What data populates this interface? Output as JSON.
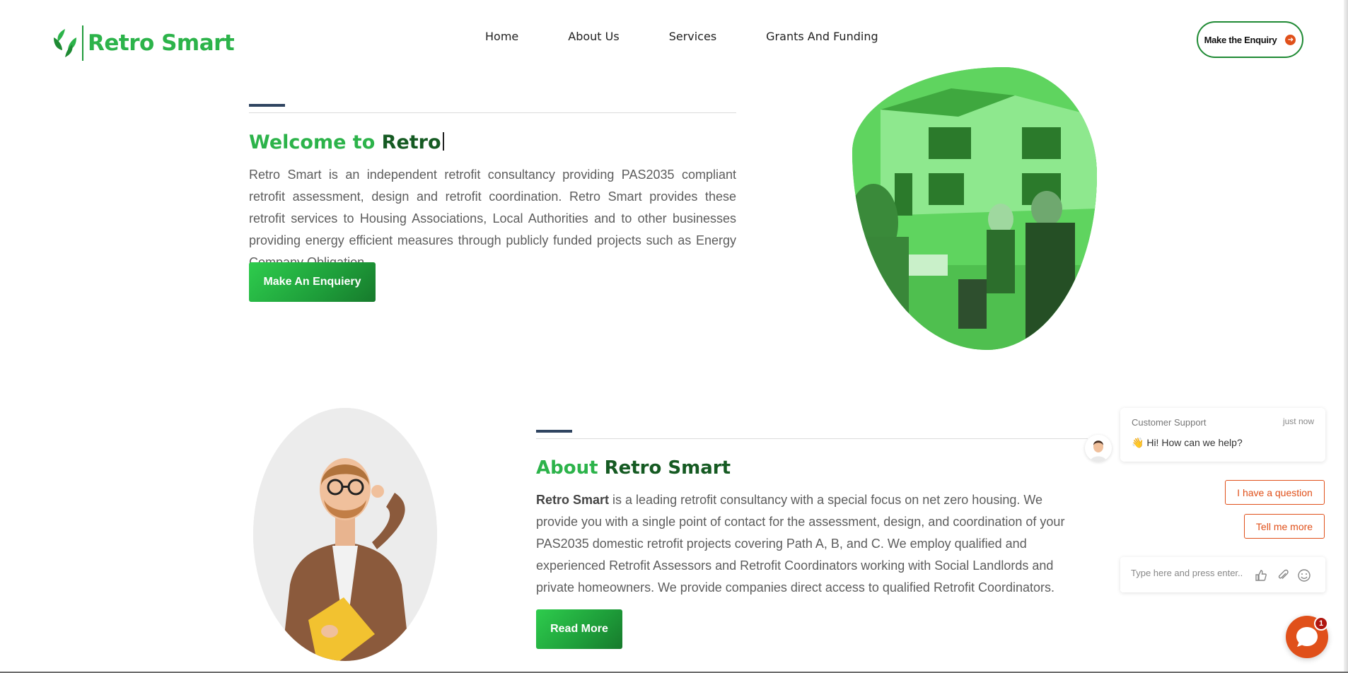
{
  "header": {
    "logo_text": "Retro Smart",
    "nav": [
      "Home",
      "About Us",
      "Services",
      "Grants And Funding"
    ],
    "cta_label": "Make the Enquiry",
    "cta_icon": "arrow-right-circle-icon"
  },
  "hero": {
    "title_part1": "Welcome to ",
    "title_part2": "Retro",
    "text": "Retro Smart is an independent retrofit consultancy providing PAS2035 compliant retrofit assessment, design and retrofit coordination. Retro Smart provides these retrofit services to Housing Associations, Local Authorities and to other businesses providing energy efficient measures through publicly funded projects such as Energy Company Obligation.",
    "button_label": "Make An Enquiery"
  },
  "about": {
    "title_part1": "About ",
    "title_part2": "Retro Smart",
    "text_bold": "Retro Smart",
    "text_rest": " is a leading retrofit consultancy with a special focus on net zero housing. We provide you with a single point of contact for the assessment, design, and coordination of your PAS2035 domestic retrofit projects covering Path A, B, and C. We employ qualified and experienced Retrofit Assessors and Retrofit Coordinators working with Social Landlords and private homeowners. We provide companies direct access to qualified Retrofit Coordinators.",
    "button_label": "Read More"
  },
  "chat": {
    "agent_name": "Customer Support",
    "time": "just now",
    "message_emoji": "👋",
    "message": "Hi! How can we help?",
    "options": [
      "I have a question",
      "Tell me more"
    ],
    "input_placeholder": "Type here and press enter..",
    "badge_count": "1",
    "colors": {
      "accent": "#e0501a",
      "badge": "#b0160f"
    }
  },
  "colors": {
    "brand_green": "#2cb34a",
    "dark_green": "#155a22",
    "deco_line": "#2f4460"
  }
}
